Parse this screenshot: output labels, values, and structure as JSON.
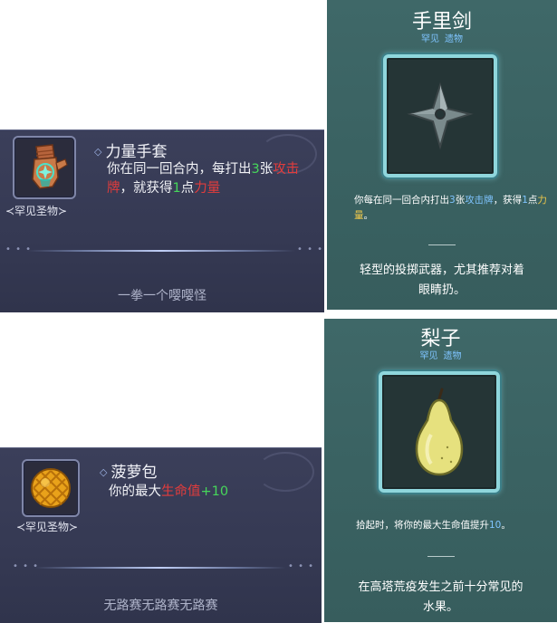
{
  "cards": [
    {
      "icon": "gauntlet-icon",
      "rarity_tag": "≺罕见圣物≻",
      "name": "力量手套",
      "desc_parts": [
        "你在同一回合内，每打出",
        "3",
        "张",
        "攻击牌",
        "，就获得",
        "1",
        "点",
        "力量"
      ],
      "flavor": "一拳一个嘤嘤怪"
    },
    {
      "icon": "pineapple-bun-icon",
      "rarity_tag": "≺罕见圣物≻",
      "name": "菠萝包",
      "desc_parts": [
        "你的最大",
        "生命值",
        "+10"
      ],
      "flavor": "无路赛无路赛无路赛"
    }
  ],
  "panels": [
    {
      "title": "手里剑",
      "subtitle": [
        "罕见",
        "遗物"
      ],
      "icon": "shuriken-icon",
      "desc_parts": [
        "你每在同一回合内打出",
        "3",
        "张",
        "攻击牌",
        "，获得",
        "1",
        "点",
        "力量",
        "。"
      ],
      "flavor": [
        "轻型的投掷武器，尤其推荐对着",
        "眼睛扔。"
      ]
    },
    {
      "title": "梨子",
      "subtitle": [
        "罕见",
        "遗物"
      ],
      "icon": "pear-icon",
      "desc_parts": [
        "拾起时，将你的最大生命值提升",
        "10",
        "。"
      ],
      "flavor": [
        "在高塔荒疫发生之前十分常见的",
        "水果。"
      ]
    }
  ],
  "colors": {
    "green": "#46d65a",
    "red": "#e23c3c",
    "blue": "#7fc4ff",
    "gold": "#f0c94a"
  }
}
